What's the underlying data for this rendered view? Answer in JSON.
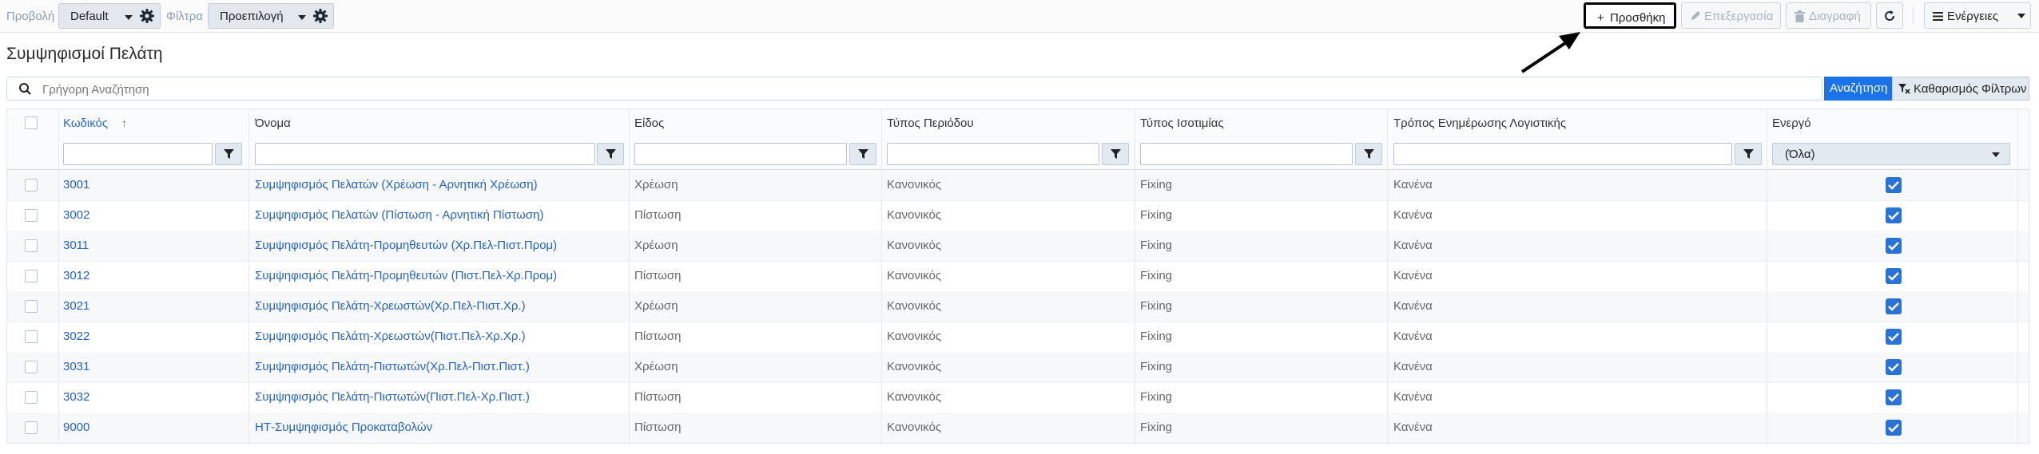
{
  "toolbar": {
    "view_label": "Προβολή",
    "view_value": "Default",
    "filter_label": "Φίλτρα",
    "filter_value": "Προεπιλογή",
    "add_label": "Προσθήκη",
    "edit_label": "Επεξεργασία",
    "delete_label": "Διαγραφή",
    "actions_label": "Ενέργειες"
  },
  "page": {
    "title": "Συμψηφισμοί Πελάτη"
  },
  "search": {
    "placeholder": "Γρήγορη Αναζήτηση",
    "value": "",
    "search_button": "Αναζήτηση",
    "clear_button": "Καθαρισμός Φίλτρων"
  },
  "grid": {
    "columns": {
      "code": "Κωδικός",
      "name": "Όνομα",
      "kind": "Είδος",
      "period_type": "Τύπος Περιόδου",
      "parity_type": "Τύπος Ισοτιμίας",
      "accounting_update": "Τρόπος Ενημέρωσης Λογιστικής",
      "active": "Ενεργό"
    },
    "sort": {
      "column": "code",
      "direction": "ascending"
    },
    "filters": {
      "code": "",
      "name": "",
      "kind": "",
      "period_type": "",
      "parity_type": "",
      "accounting_update": "",
      "active": "(Όλα)"
    },
    "rows": [
      {
        "code": "3001",
        "name": "Συμψηφισμός Πελατών (Χρέωση - Αρνητική Χρέωση)",
        "kind": "Χρέωση",
        "period_type": "Κανονικός",
        "parity_type": "Fixing",
        "accounting_update": "Κανένα",
        "active": true
      },
      {
        "code": "3002",
        "name": "Συμψηφισμός Πελατών (Πίστωση - Αρνητική Πίστωση)",
        "kind": "Πίστωση",
        "period_type": "Κανονικός",
        "parity_type": "Fixing",
        "accounting_update": "Κανένα",
        "active": true
      },
      {
        "code": "3011",
        "name": "Συμψηφισμός Πελάτη-Προμηθευτών (Χρ.Πελ-Πιστ.Προμ)",
        "kind": "Χρέωση",
        "period_type": "Κανονικός",
        "parity_type": "Fixing",
        "accounting_update": "Κανένα",
        "active": true
      },
      {
        "code": "3012",
        "name": "Συμψηφισμός Πελάτη-Προμηθευτών (Πιστ.Πελ-Χρ.Προμ)",
        "kind": "Πίστωση",
        "period_type": "Κανονικός",
        "parity_type": "Fixing",
        "accounting_update": "Κανένα",
        "active": true
      },
      {
        "code": "3021",
        "name": "Συμψηφισμός Πελάτη-Χρεωστών(Χρ.Πελ-Πιστ.Χρ.)",
        "kind": "Χρέωση",
        "period_type": "Κανονικός",
        "parity_type": "Fixing",
        "accounting_update": "Κανένα",
        "active": true
      },
      {
        "code": "3022",
        "name": "Συμψηφισμός Πελάτη-Χρεωστών(Πιστ.Πελ-Χρ.Χρ.)",
        "kind": "Πίστωση",
        "period_type": "Κανονικός",
        "parity_type": "Fixing",
        "accounting_update": "Κανένα",
        "active": true
      },
      {
        "code": "3031",
        "name": "Συμψηφισμός Πελάτη-Πιστωτών(Χρ.Πελ-Πιστ.Πιστ.)",
        "kind": "Χρέωση",
        "period_type": "Κανονικός",
        "parity_type": "Fixing",
        "accounting_update": "Κανένα",
        "active": true
      },
      {
        "code": "3032",
        "name": "Συμψηφισμός Πελάτη-Πιστωτών(Πιστ.Πελ-Χρ.Πιστ.)",
        "kind": "Πίστωση",
        "period_type": "Κανονικός",
        "parity_type": "Fixing",
        "accounting_update": "Κανένα",
        "active": true
      },
      {
        "code": "9000",
        "name": "ΗΤ-Συμψηφισμός Προκαταβολών",
        "kind": "Πίστωση",
        "period_type": "Κανονικός",
        "parity_type": "Fixing",
        "accounting_update": "Κανένα",
        "active": true
      }
    ]
  },
  "colors": {
    "accent": "#1a73e8",
    "link": "#2463c5",
    "checkbox_checked": "#2a73d6"
  }
}
